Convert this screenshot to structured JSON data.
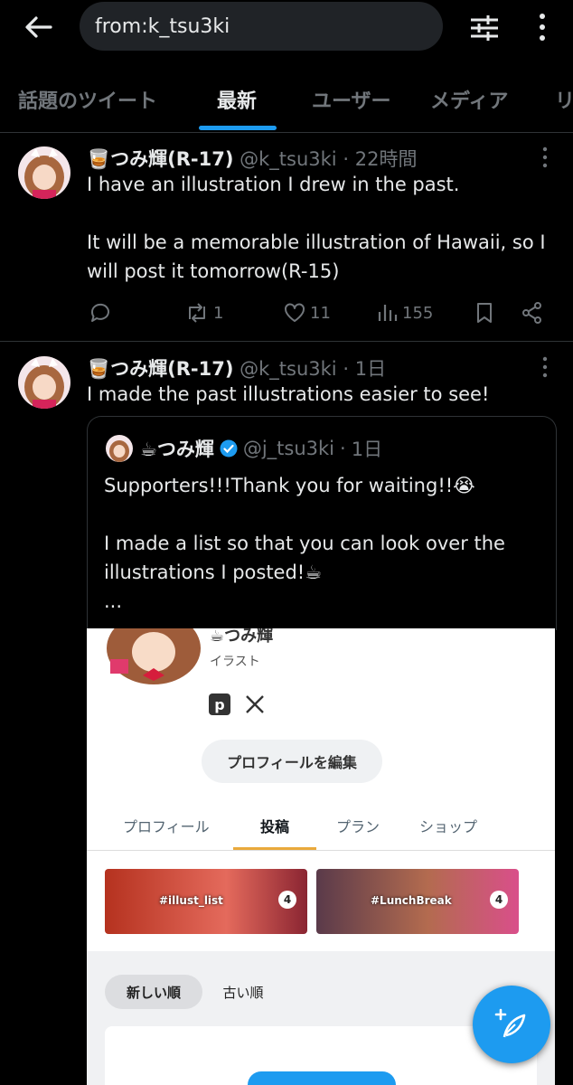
{
  "search": {
    "query": "from:k_tsu3ki"
  },
  "tabs": [
    {
      "label": "話題のツイート"
    },
    {
      "label": "最新"
    },
    {
      "label": "ユーザー"
    },
    {
      "label": "メディア"
    },
    {
      "label": "リ"
    }
  ],
  "active_tab": "最新",
  "tweets": [
    {
      "name": "🥃つみ輝(R-17)",
      "handle": "@k_tsu3ki",
      "time": "22時間",
      "text": "I have an illustration I drew in the past.\n\nIt will be a memorable illustration of Hawaii, so I will post it tomorrow(R-15)",
      "stats": {
        "retweets": "1",
        "likes": "11",
        "views": "155"
      }
    },
    {
      "name": "🥃つみ輝(R-17)",
      "handle": "@k_tsu3ki",
      "time": "1日",
      "text": "I made the past illustrations easier to see!",
      "quote": {
        "name": "☕つみ輝",
        "handle": "@j_tsu3ki",
        "time": "1日",
        "text": "Supporters!!!Thank you for waiting!!😭\n\nI made a list so that you can look over the illustrations I posted!☕\n...",
        "media": {
          "profile_name": "☕つみ輝",
          "profile_sub": "イラスト",
          "edit_button": "プロフィールを編集",
          "tabs": [
            "プロフィール",
            "投稿",
            "プラン",
            "ショップ"
          ],
          "active_tab": "投稿",
          "collections": [
            {
              "label": "#illust_list",
              "count": "4"
            },
            {
              "label": "#LunchBreak",
              "count": "4"
            }
          ],
          "sort_options": [
            "新しい順",
            "古い順"
          ],
          "active_sort": "新しい順"
        }
      }
    }
  ],
  "colors": {
    "accent": "#1d9bf0",
    "background": "#000000",
    "muted": "#71767b"
  },
  "icons": [
    "back-arrow-icon",
    "filter-icon",
    "more-vertical-icon",
    "reply-icon",
    "retweet-icon",
    "like-icon",
    "views-icon",
    "bookmark-icon",
    "share-icon",
    "verified-icon",
    "compose-icon"
  ]
}
